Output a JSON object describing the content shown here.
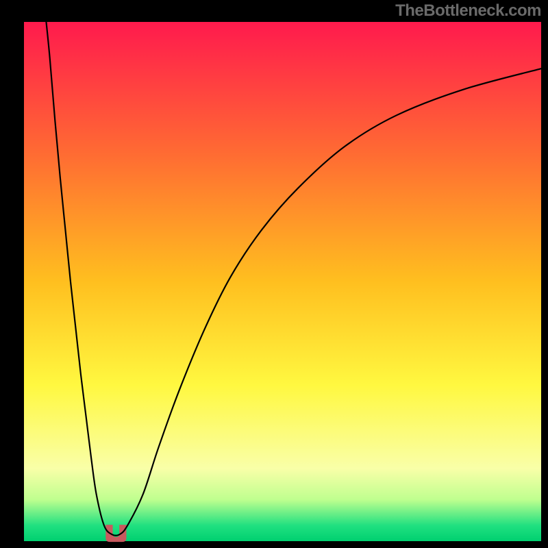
{
  "watermark": "TheBottleneck.com",
  "chart_data": {
    "type": "line",
    "title": "",
    "xlabel": "",
    "ylabel": "",
    "xlim": [
      0,
      100
    ],
    "ylim": [
      0,
      100
    ],
    "grid": false,
    "background_gradient": {
      "type": "vertical",
      "stops": [
        {
          "pos": 0.0,
          "color": "#ff1a4d"
        },
        {
          "pos": 0.25,
          "color": "#ff6a33"
        },
        {
          "pos": 0.5,
          "color": "#ffbf1f"
        },
        {
          "pos": 0.7,
          "color": "#fff840"
        },
        {
          "pos": 0.86,
          "color": "#f9ffa8"
        },
        {
          "pos": 0.92,
          "color": "#bfff8f"
        },
        {
          "pos": 0.97,
          "color": "#20e080"
        },
        {
          "pos": 1.0,
          "color": "#00d070"
        }
      ]
    },
    "series": [
      {
        "name": "bottleneck-curve",
        "stroke": "#000000",
        "stroke_width": 2.2,
        "x": [
          4.3,
          5,
          6,
          7,
          8,
          9,
          10,
          11,
          12,
          13,
          14,
          15.5,
          17,
          18.5,
          20,
          23,
          26,
          30,
          35,
          40,
          46,
          53,
          62,
          72,
          85,
          100
        ],
        "values": [
          100,
          93,
          81,
          70,
          60,
          50,
          41,
          32,
          24,
          16,
          9,
          3,
          1.3,
          1.3,
          3,
          9,
          18,
          29,
          41,
          51,
          60,
          68,
          76,
          82,
          87,
          91
        ]
      }
    ],
    "marker": {
      "name": "optimum-marker",
      "color": "#c9595e",
      "x": 17.8,
      "y": 1.5,
      "width_x": 4.0,
      "height_y": 3.3
    }
  }
}
